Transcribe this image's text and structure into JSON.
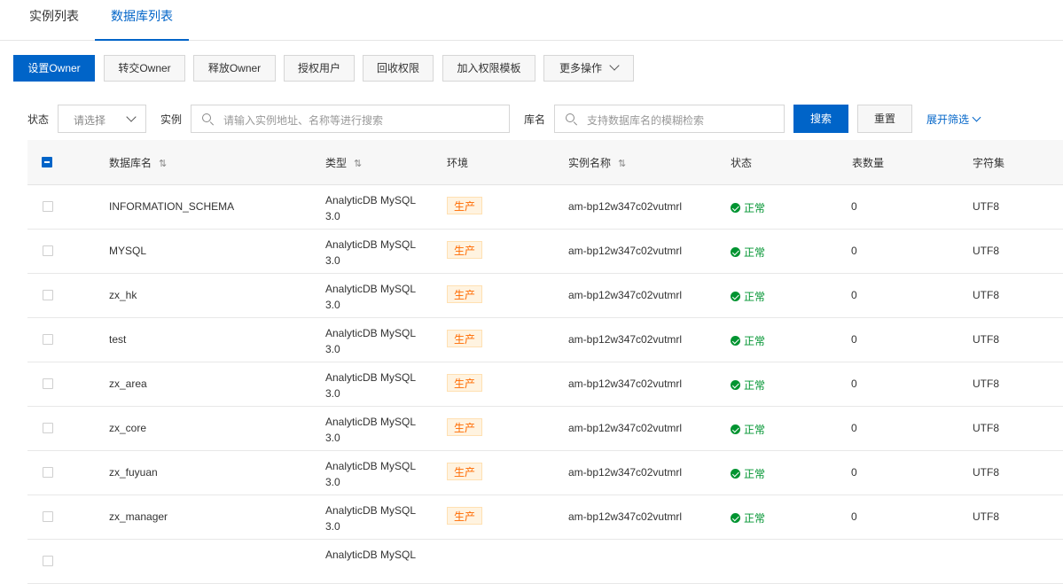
{
  "tabs": [
    {
      "label": "实例列表",
      "active": false
    },
    {
      "label": "数据库列表",
      "active": true
    }
  ],
  "toolbar": {
    "set_owner": "设置Owner",
    "transfer_owner": "转交Owner",
    "release_owner": "释放Owner",
    "authorize_user": "授权用户",
    "revoke": "回收权限",
    "add_template": "加入权限模板",
    "more": "更多操作"
  },
  "filters": {
    "status_label": "状态",
    "status_placeholder": "请选择",
    "instance_label": "实例",
    "instance_placeholder": "请输入实例地址、名称等进行搜索",
    "db_label": "库名",
    "db_placeholder": "支持数据库名的模糊检索",
    "search": "搜索",
    "reset": "重置",
    "expand": "展开筛选"
  },
  "table": {
    "headers": {
      "name": "数据库名",
      "type": "类型",
      "env": "环境",
      "instance": "实例名称",
      "status": "状态",
      "tables": "表数量",
      "charset": "字符集"
    },
    "rows": [
      {
        "name": "INFORMATION_SCHEMA",
        "type": "AnalyticDB MySQL 3.0",
        "env": "生产",
        "instance": "am-bp12w347c02vutmrl",
        "status": "正常",
        "tables": "0",
        "charset": "UTF8"
      },
      {
        "name": "MYSQL",
        "type": "AnalyticDB MySQL 3.0",
        "env": "生产",
        "instance": "am-bp12w347c02vutmrl",
        "status": "正常",
        "tables": "0",
        "charset": "UTF8"
      },
      {
        "name": "zx_hk",
        "type": "AnalyticDB MySQL 3.0",
        "env": "生产",
        "instance": "am-bp12w347c02vutmrl",
        "status": "正常",
        "tables": "0",
        "charset": "UTF8"
      },
      {
        "name": "test",
        "type": "AnalyticDB MySQL 3.0",
        "env": "生产",
        "instance": "am-bp12w347c02vutmrl",
        "status": "正常",
        "tables": "0",
        "charset": "UTF8"
      },
      {
        "name": "zx_area",
        "type": "AnalyticDB MySQL 3.0",
        "env": "生产",
        "instance": "am-bp12w347c02vutmrl",
        "status": "正常",
        "tables": "0",
        "charset": "UTF8"
      },
      {
        "name": "zx_core",
        "type": "AnalyticDB MySQL 3.0",
        "env": "生产",
        "instance": "am-bp12w347c02vutmrl",
        "status": "正常",
        "tables": "0",
        "charset": "UTF8"
      },
      {
        "name": "zx_fuyuan",
        "type": "AnalyticDB MySQL 3.0",
        "env": "生产",
        "instance": "am-bp12w347c02vutmrl",
        "status": "正常",
        "tables": "0",
        "charset": "UTF8"
      },
      {
        "name": "zx_manager",
        "type": "AnalyticDB MySQL 3.0",
        "env": "生产",
        "instance": "am-bp12w347c02vutmrl",
        "status": "正常",
        "tables": "0",
        "charset": "UTF8"
      },
      {
        "name": "",
        "type": "AnalyticDB MySQL",
        "env": "",
        "instance": "",
        "status": "",
        "tables": "",
        "charset": ""
      }
    ]
  },
  "colors": {
    "accent": "#0064c8",
    "success": "#009431",
    "tag_text": "#ff6a00",
    "tag_bg": "#fff3e0"
  }
}
